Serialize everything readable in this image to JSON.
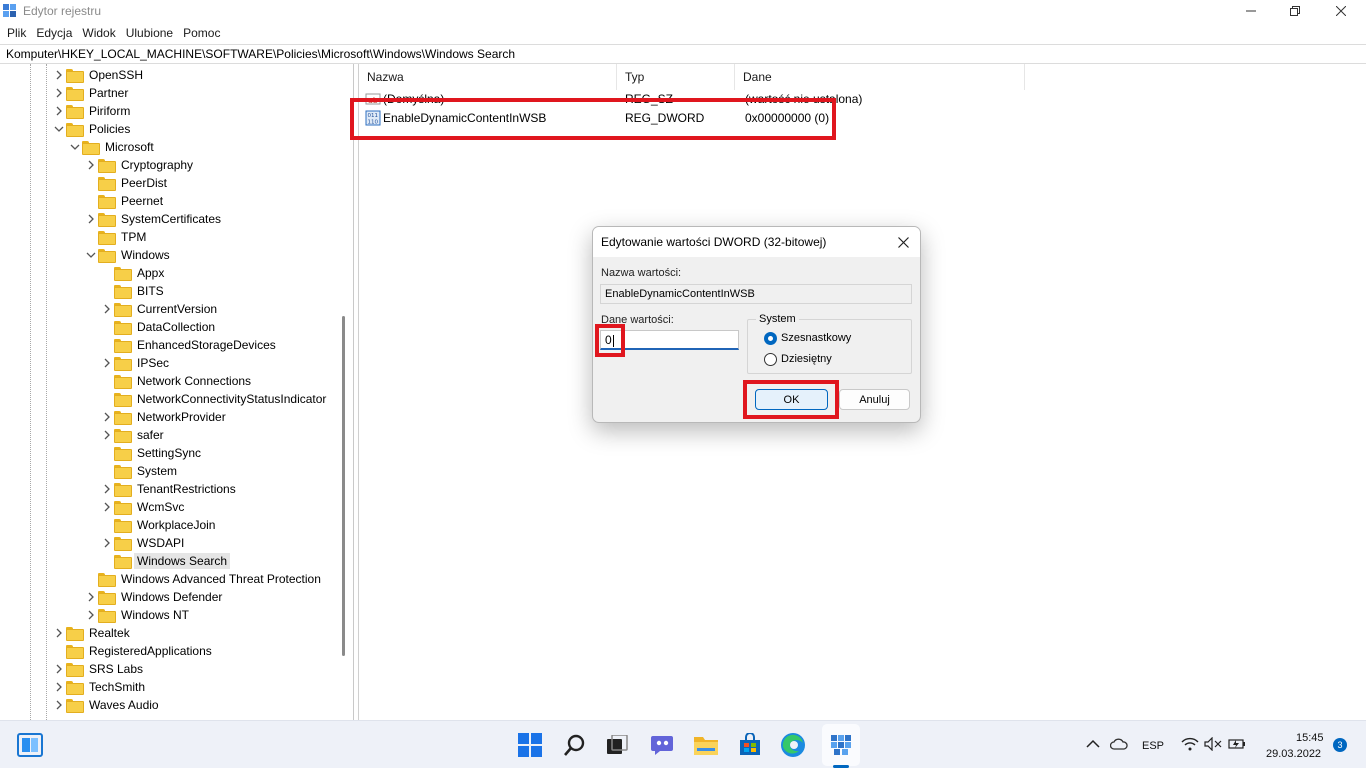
{
  "window": {
    "title": "Edytor rejestru",
    "menu": [
      "Plik",
      "Edycja",
      "Widok",
      "Ulubione",
      "Pomoc"
    ],
    "address": "Komputer\\HKEY_LOCAL_MACHINE\\SOFTWARE\\Policies\\Microsoft\\Windows\\Windows Search"
  },
  "tree": {
    "items": [
      {
        "label": "OpenSSH",
        "expander": "collapsed"
      },
      {
        "label": "Partner",
        "expander": "collapsed"
      },
      {
        "label": "Piriform",
        "expander": "collapsed"
      },
      {
        "label": "Policies",
        "expander": "expanded"
      },
      {
        "label": "Microsoft",
        "expander": "expanded"
      },
      {
        "label": "Cryptography",
        "expander": "collapsed"
      },
      {
        "label": "PeerDist",
        "expander": "none"
      },
      {
        "label": "Peernet",
        "expander": "none"
      },
      {
        "label": "SystemCertificates",
        "expander": "collapsed"
      },
      {
        "label": "TPM",
        "expander": "none"
      },
      {
        "label": "Windows",
        "expander": "expanded"
      },
      {
        "label": "Appx",
        "expander": "none"
      },
      {
        "label": "BITS",
        "expander": "none"
      },
      {
        "label": "CurrentVersion",
        "expander": "collapsed"
      },
      {
        "label": "DataCollection",
        "expander": "none"
      },
      {
        "label": "EnhancedStorageDevices",
        "expander": "none"
      },
      {
        "label": "IPSec",
        "expander": "collapsed"
      },
      {
        "label": "Network Connections",
        "expander": "none"
      },
      {
        "label": "NetworkConnectivityStatusIndicator",
        "expander": "none"
      },
      {
        "label": "NetworkProvider",
        "expander": "collapsed"
      },
      {
        "label": "safer",
        "expander": "collapsed"
      },
      {
        "label": "SettingSync",
        "expander": "none"
      },
      {
        "label": "System",
        "expander": "none"
      },
      {
        "label": "TenantRestrictions",
        "expander": "collapsed"
      },
      {
        "label": "WcmSvc",
        "expander": "collapsed"
      },
      {
        "label": "WorkplaceJoin",
        "expander": "none"
      },
      {
        "label": "WSDAPI",
        "expander": "collapsed"
      },
      {
        "label": "Windows Search",
        "expander": "none",
        "selected": true
      },
      {
        "label": "Windows Advanced Threat Protection",
        "expander": "none"
      },
      {
        "label": "Windows Defender",
        "expander": "collapsed"
      },
      {
        "label": "Windows NT",
        "expander": "collapsed"
      },
      {
        "label": "Realtek",
        "expander": "collapsed"
      },
      {
        "label": "RegisteredApplications",
        "expander": "none"
      },
      {
        "label": "SRS Labs",
        "expander": "collapsed"
      },
      {
        "label": "TechSmith",
        "expander": "collapsed"
      },
      {
        "label": "Waves Audio",
        "expander": "collapsed"
      }
    ]
  },
  "list": {
    "columns": [
      "Nazwa",
      "Typ",
      "Dane"
    ],
    "rows": [
      {
        "name": "(Domyślna)",
        "type": "REG_SZ",
        "data": "(wartość nie ustalona)",
        "icon": "string-value-icon"
      },
      {
        "name": "EnableDynamicContentInWSB",
        "type": "REG_DWORD",
        "data": "0x00000000 (0)",
        "icon": "binary-value-icon"
      }
    ]
  },
  "dialog": {
    "title": "Edytowanie wartości DWORD (32-bitowej)",
    "name_label": "Nazwa wartości:",
    "name_value": "EnableDynamicContentInWSB",
    "data_label": "Dane wartości:",
    "data_value": "0",
    "base_label": "System",
    "base_options": [
      "Szesnastkowy",
      "Dziesiętny"
    ],
    "base_selected": "Szesnastkowy",
    "ok_label": "OK",
    "cancel_label": "Anuluj"
  },
  "taskbar": {
    "apps": [
      "start-icon",
      "search-icon",
      "task-view-icon",
      "chat-icon",
      "file-explorer-icon",
      "store-icon",
      "edge-icon",
      "regedit-icon"
    ],
    "active_app": "regedit-icon",
    "language": "ESP",
    "time": "15:45",
    "date": "29.03.2022",
    "notification_count": "3"
  },
  "colors": {
    "highlight_red": "#e0161e",
    "accent": "#0067c0",
    "folder": "#f7cf48"
  }
}
